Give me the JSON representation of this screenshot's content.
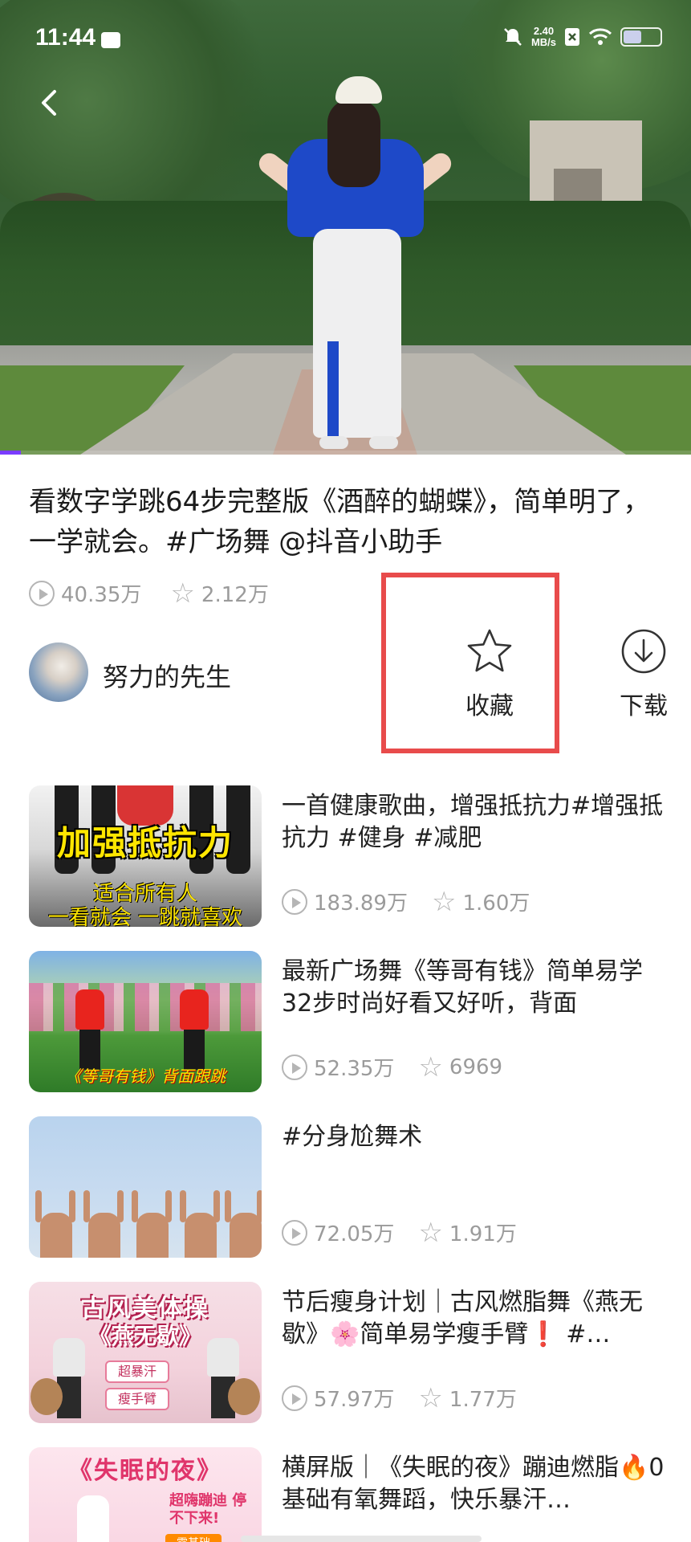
{
  "status_bar": {
    "time": "11:44",
    "net_speed_value": "2.40",
    "net_speed_unit": "MB/s",
    "battery_level": 0.55
  },
  "video": {
    "progress": 0.03
  },
  "post": {
    "title": "看数字学跳64步完整版《酒醉的蝴蝶》，简单明了，一学就会。#广场舞 @抖音小助手",
    "plays": "40.35万",
    "likes": "2.12万",
    "author": "努力的先生"
  },
  "actions": {
    "favorite_label": "收藏",
    "download_label": "下载"
  },
  "related": [
    {
      "title": "一首健康歌曲，增强抵抗力#增强抵抗力 #健身 #减肥",
      "plays": "183.89万",
      "likes": "1.60万",
      "thumb_text_1": "加强抵抗力",
      "thumb_text_2": "适合所有人",
      "thumb_text_3": "一看就会 一跳就喜欢"
    },
    {
      "title": "最新广场舞《等哥有钱》简单易学32步时尚好看又好听，背面",
      "plays": "52.35万",
      "likes": "6969",
      "thumb_text_1": "《等哥有钱》背面跟跳"
    },
    {
      "title": "#分身尬舞术",
      "plays": "72.05万",
      "likes": "1.91万"
    },
    {
      "title": "节后瘦身计划｜古风燃脂舞《燕无歇》🌸简单易学瘦手臂❗ #…",
      "plays": "57.97万",
      "likes": "1.77万",
      "thumb_text_1": "古风美体操",
      "thumb_text_2": "《燕无歇》",
      "thumb_text_3": "超暴汗",
      "thumb_text_4": "瘦手臂"
    },
    {
      "title": "横屏版｜《失眠的夜》蹦迪燃脂🔥0基础有氧舞蹈，快乐暴汗…",
      "thumb_text_1": "《失眠的夜》",
      "thumb_text_2": "超嗨蹦迪 停不下来!",
      "thumb_text_3": "零基础"
    }
  ],
  "icons": {
    "back": "chevron-left-icon",
    "play_count": "play-circle-icon",
    "like_count": "star-outline-icon",
    "favorite": "star-outline-icon",
    "download": "download-circle-icon"
  },
  "colors": {
    "highlight_border": "#e84b4b",
    "progress": "#7a3cff",
    "meta_text": "#9b9b9b"
  }
}
